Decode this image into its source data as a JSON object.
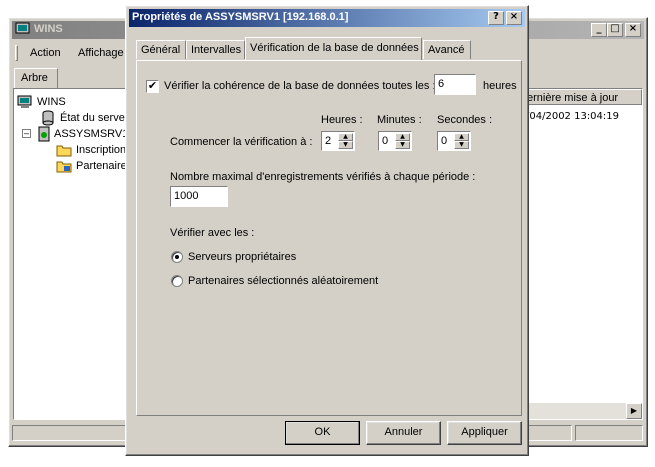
{
  "mmc": {
    "title": "WINS",
    "menu": {
      "action": "Action",
      "view": "Affichage"
    },
    "tree_tab": "Arbre",
    "tree": [
      {
        "label": "WINS"
      },
      {
        "label": "État du serveur"
      },
      {
        "label": "ASSYSMSRV1 ["
      },
      {
        "label": "Inscriptions"
      },
      {
        "label": "Partenaires"
      }
    ],
    "column_header": "ernière mise à jour",
    "cell": "/04/2002 13:04:19",
    "caption": {
      "minimize": "_",
      "maximize": "□",
      "close": "×"
    }
  },
  "dialog": {
    "title": "Propriétés de ASSYSMSRV1 [192.168.0.1]",
    "help_button": "?",
    "close_button": "×",
    "tabs": [
      "Général",
      "Intervalles",
      "Vérification de la base de données",
      "Avancé"
    ],
    "verify_checkbox_label": "Vérifier la cohérence de la base de données toutes les :",
    "verify_checked": true,
    "verify_hours_value": "6",
    "verify_hours_unit": "heures",
    "spin_headers": {
      "hours": "Heures :",
      "minutes": "Minutes :",
      "seconds": "Secondes :"
    },
    "start_label": "Commencer la vérification à :",
    "start_time": {
      "hours": "2",
      "minutes": "0",
      "seconds": "0"
    },
    "max_records_label": "Nombre maximal d'enregistrements vérifiés à chaque période :",
    "max_records_value": "1000",
    "verify_with_label": "Vérifier avec les :",
    "radio_options": [
      {
        "label": "Serveurs propriétaires",
        "selected": true
      },
      {
        "label": "Partenaires sélectionnés aléatoirement",
        "selected": false
      }
    ],
    "buttons": {
      "ok": "OK",
      "cancel": "Annuler",
      "apply": "Appliquer"
    }
  }
}
